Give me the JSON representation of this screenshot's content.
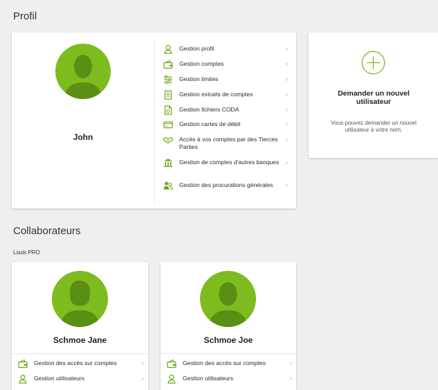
{
  "profile": {
    "section_title": "Profil",
    "name": "John",
    "menu": [
      {
        "label": "Gestion profil",
        "icon": "user-icon"
      },
      {
        "label": "Gestion comptes",
        "icon": "wallet-icon"
      },
      {
        "label": "Gestion limites",
        "icon": "sliders-icon"
      },
      {
        "label": "Gestion extraits de comptes",
        "icon": "document-icon"
      },
      {
        "label": "Gestion fichiers CODA",
        "icon": "file-icon"
      },
      {
        "label": "Gestion cartes de débit",
        "icon": "card-icon"
      },
      {
        "label": "Accès à vos comptes par des Tierces Parties",
        "icon": "handshake-icon"
      },
      {
        "label": "Gestion de comptes d'autres banques",
        "icon": "bank-icon"
      },
      {
        "label": "Gestion des procurations générales",
        "icon": "users-icon"
      }
    ]
  },
  "new_user": {
    "title": "Demander un nouvel utilisateur",
    "description": "Vous pouvez demander un nouvel utilisateur à votre nom."
  },
  "collaborators": {
    "section_title": "Collaborateurs",
    "company": "Louis PRO",
    "people": [
      {
        "name": "Schmoe Jane",
        "menu": [
          {
            "label": "Gestion des accès sur comptes",
            "icon": "wallet-icon"
          },
          {
            "label": "Gestion utilisateurs",
            "icon": "user-icon"
          }
        ]
      },
      {
        "name": "Schmoe Joe",
        "menu": [
          {
            "label": "Gestion des accès sur comptes",
            "icon": "wallet-icon"
          },
          {
            "label": "Gestion utilisateurs",
            "icon": "user-icon"
          }
        ]
      }
    ]
  },
  "colors": {
    "accent": "#7dbb1f",
    "icon": "#6aa71a",
    "background": "#efefef"
  }
}
